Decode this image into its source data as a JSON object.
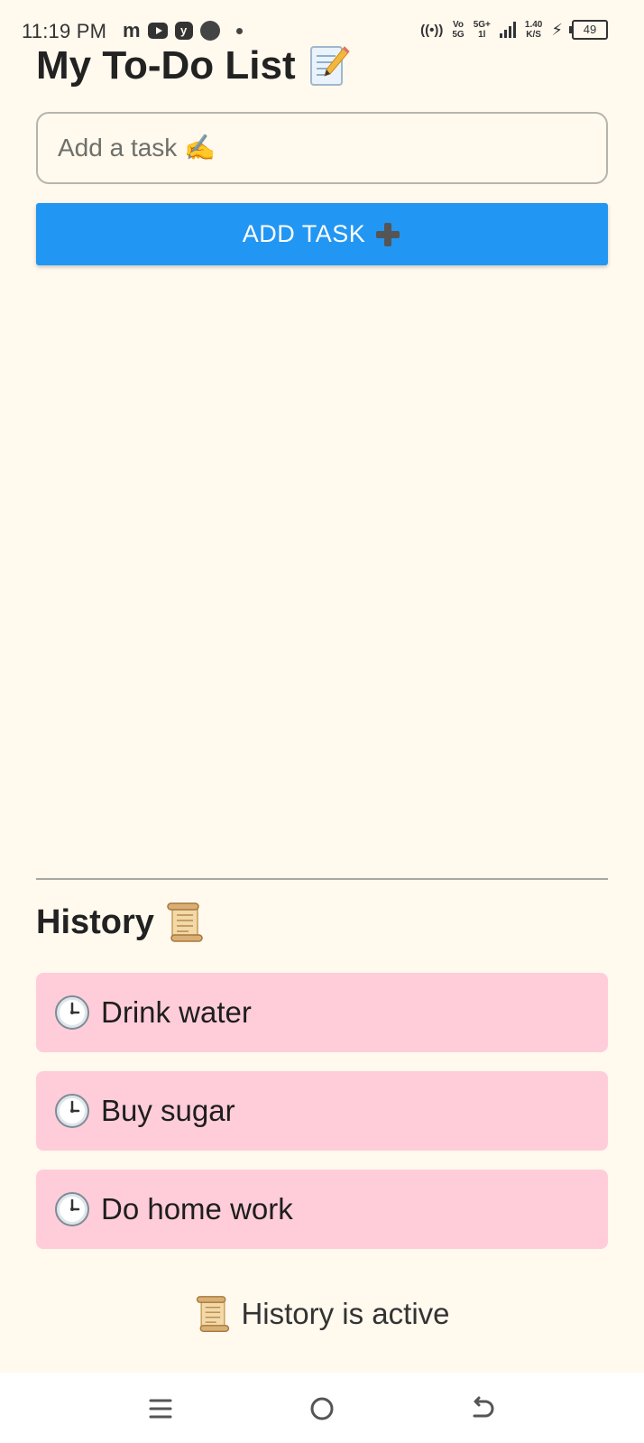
{
  "status_bar": {
    "time": "11:19 PM",
    "left_icons": [
      "m",
      "youtube-icon",
      "y",
      "circle-icon",
      "dot-icon"
    ],
    "hotspot": "((•))",
    "volte_top": "Vo",
    "volte_bottom": "5G",
    "network_top": "5G+",
    "network_bottom": "1l",
    "speed_top": "1.40",
    "speed_bottom": "K/S",
    "battery": "49"
  },
  "app": {
    "title": "My To-Do List",
    "title_icon": "memo-icon"
  },
  "task_input": {
    "placeholder": "Add a task ✍️",
    "value": ""
  },
  "add_button": {
    "label": "ADD TASK",
    "icon": "plus-icon",
    "color": "#2196f3"
  },
  "history": {
    "heading": "History",
    "heading_icon": "scroll-icon",
    "item_color": "#ffcdd9",
    "items": [
      {
        "label": "Drink water",
        "icon": "clock-icon"
      },
      {
        "label": "Buy sugar",
        "icon": "clock-icon"
      },
      {
        "label": "Do home work",
        "icon": "clock-icon"
      }
    ]
  },
  "status_message": {
    "text": "History is active",
    "icon": "scroll-icon"
  },
  "nav_bar": {
    "buttons": [
      "menu-icon",
      "home-icon",
      "back-icon"
    ]
  },
  "colors": {
    "background": "#fff9ee",
    "accent": "#2196f3",
    "history_item": "#ffcdd9"
  }
}
